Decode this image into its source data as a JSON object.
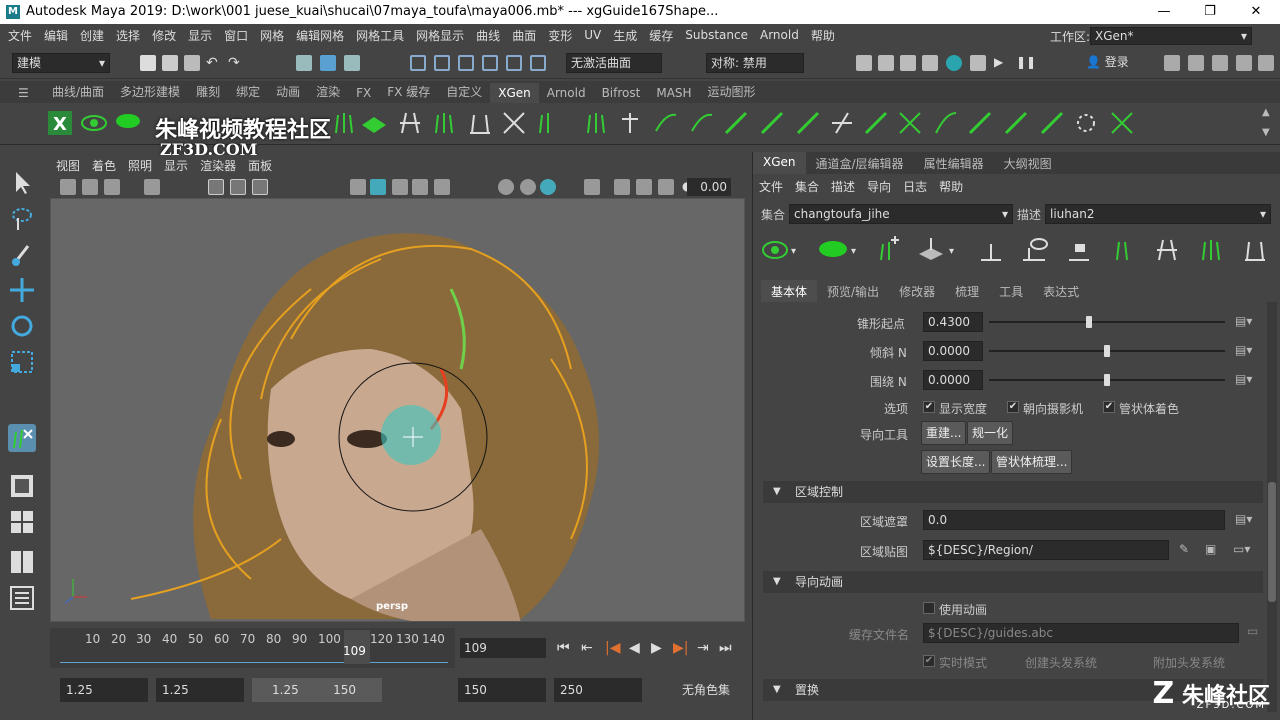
{
  "title_bar": {
    "title": "Autodesk Maya 2019: D:\\work\\001 juese_kuai\\shucai\\07maya_toufa\\maya006.mb*   ---   xgGuide167Shape..."
  },
  "menu_bar": {
    "items": [
      "文件",
      "编辑",
      "创建",
      "选择",
      "修改",
      "显示",
      "窗口",
      "网格",
      "编辑网格",
      "网格工具",
      "网格显示",
      "曲线",
      "曲面",
      "变形",
      "UV",
      "生成",
      "缓存",
      "Substance",
      "Arnold",
      "帮助"
    ],
    "workspace_label": "工作区:",
    "workspace_value": "XGen*"
  },
  "status_line": {
    "mode": "建模",
    "live_surface": "无激活曲面",
    "symmetry": "对称: 禁用",
    "login": "登录"
  },
  "shelf_tabs": [
    "曲线/曲面",
    "多边形建模",
    "雕刻",
    "绑定",
    "动画",
    "渲染",
    "FX",
    "FX 缓存",
    "自定义",
    "XGen",
    "Arnold",
    "Bifrost",
    "MASH",
    "运动图形"
  ],
  "shelf_active_tab": "XGen",
  "watermark": {
    "line1": "朱峰视频教程社区",
    "line2": "ZF3D.COM"
  },
  "viewport": {
    "menu": [
      "视图",
      "着色",
      "照明",
      "显示",
      "渲染器",
      "面板"
    ],
    "frame_value": "0.00",
    "camera_label": "persp"
  },
  "timeline": {
    "ticks": [
      "10",
      "20",
      "30",
      "40",
      "50",
      "60",
      "70",
      "80",
      "90",
      "100",
      "110",
      "120",
      "130",
      "140"
    ],
    "current_frame": "109",
    "current_frame_field": "109"
  },
  "range_slider": {
    "start": "1.25",
    "anim_start": "1.25",
    "range_start": "1.25",
    "range_end": "150",
    "anim_end": "150",
    "end": "250",
    "character_set": "无角色集"
  },
  "xgen": {
    "tabs": [
      "XGen",
      "通道盒/层编辑器",
      "属性编辑器",
      "大纲视图"
    ],
    "active_tab": "XGen",
    "menu": [
      "文件",
      "集合",
      "描述",
      "导向",
      "日志",
      "帮助"
    ],
    "collection_label": "集合",
    "collection_value": "changtoufa_jihe",
    "description_label": "描述",
    "description_value": "liuhan2",
    "sub_tabs": [
      "基本体",
      "预览/输出",
      "修改器",
      "梳理",
      "工具",
      "表达式"
    ],
    "active_sub_tab": "基本体",
    "taper_start_label": "锥形起点",
    "taper_start_value": "0.4300",
    "taper_start_level": 0.43,
    "tilt_n_label": "倾斜 N",
    "tilt_n_value": "0.0000",
    "tilt_n_level": 0.5,
    "around_n_label": "围绕 N",
    "around_n_value": "0.0000",
    "around_n_level": 0.5,
    "options_label": "选项",
    "opt_show_width": "显示宽度",
    "opt_face_camera": "朝向摄影机",
    "opt_tube_shade": "管状体着色",
    "guide_tools_label": "导向工具",
    "btn_rebuild": "重建...",
    "btn_normalize": "规一化",
    "btn_set_length": "设置长度...",
    "btn_tube_comb": "管状体梳理...",
    "section_region": "区域控制",
    "region_mask_label": "区域遮罩",
    "region_mask_value": "0.0",
    "region_map_label": "区域贴图",
    "region_map_value": "${DESC}/Region/",
    "section_guide_anim": "导向动画",
    "use_animation": "使用动画",
    "cache_file_label": "缓存文件名",
    "cache_file_value": "${DESC}/guides.abc",
    "live_mode": "实时模式",
    "create_hair_system": "创建头发系统",
    "attach_hair_system": "附加头发系统",
    "section_replace": "置换"
  },
  "brand": {
    "text": "朱峰社区",
    "sub": "ZF3D.COM"
  }
}
